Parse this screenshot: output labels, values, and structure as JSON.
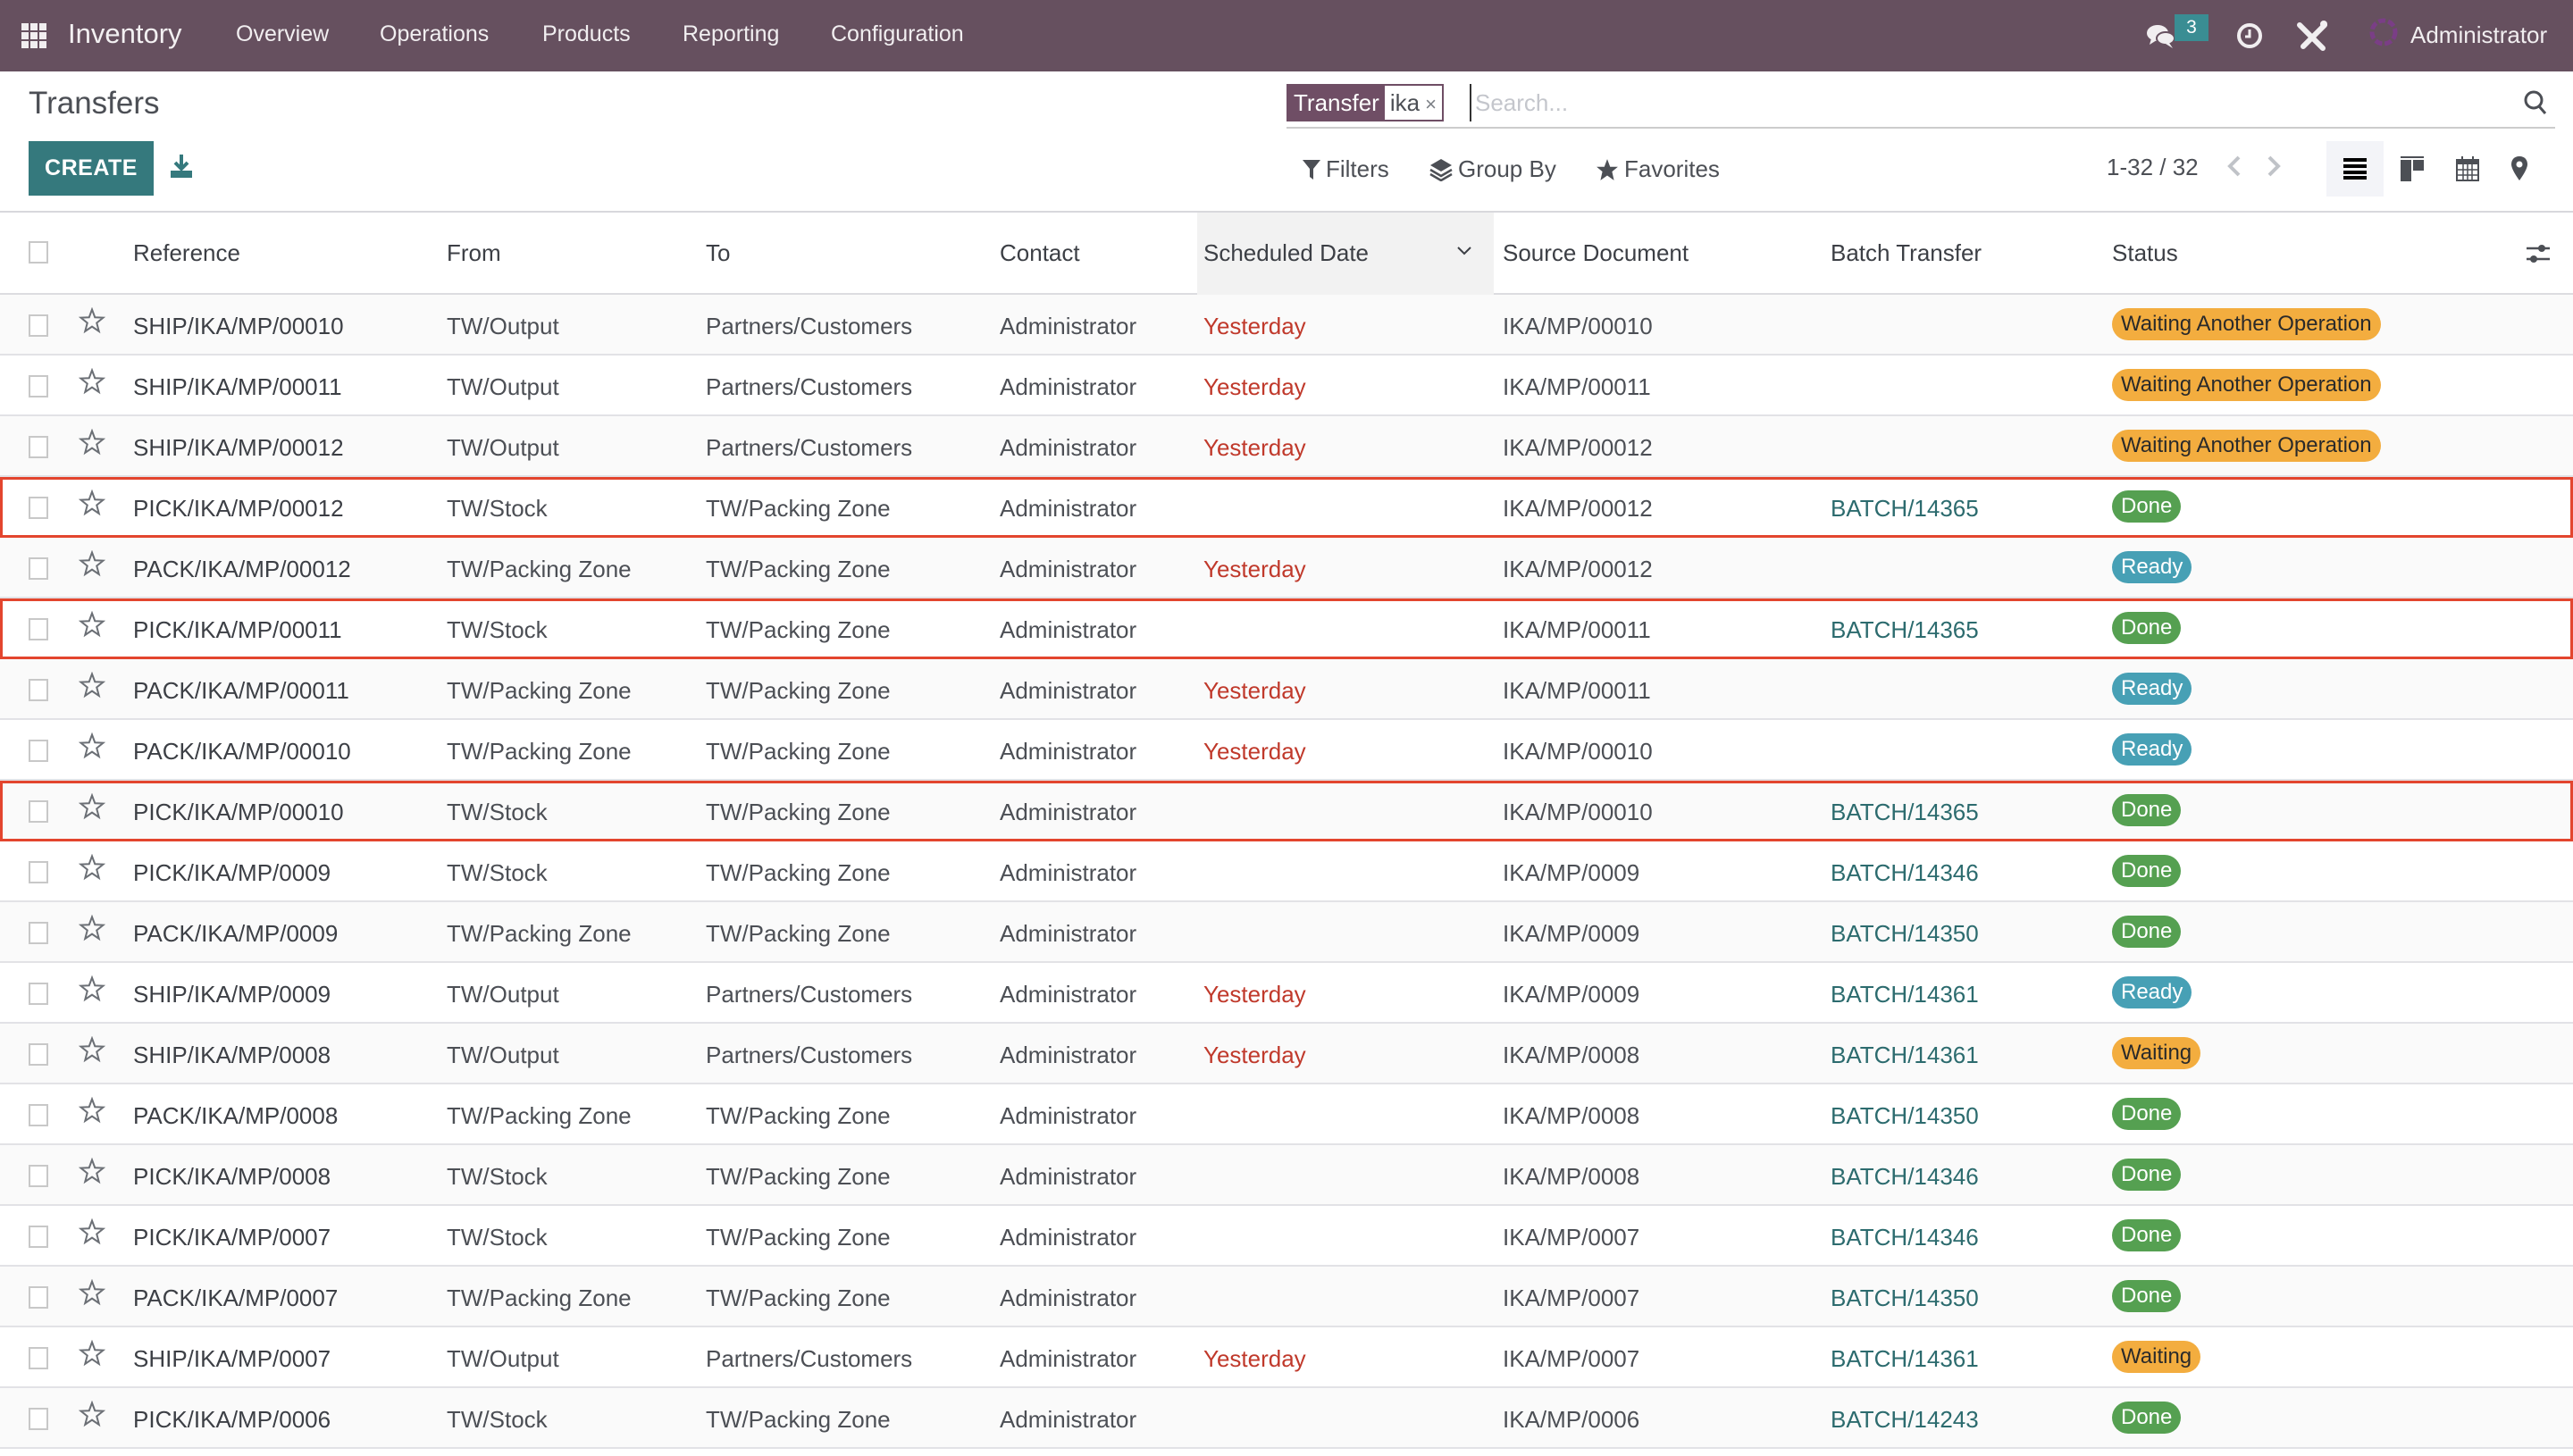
{
  "navbar": {
    "app_name": "Inventory",
    "menu": [
      "Overview",
      "Operations",
      "Products",
      "Reporting",
      "Configuration"
    ],
    "messages_count": "3",
    "user": "Administrator",
    "icons": [
      "apps-grid-icon",
      "chat-icon",
      "clock-icon",
      "tools-icon",
      "company-logo"
    ]
  },
  "control_panel": {
    "title": "Transfers",
    "create_label": "CREATE",
    "search": {
      "facet_label": "Transfer",
      "facet_value": "ika",
      "facet_remove": "×",
      "placeholder": "Search..."
    },
    "filters_label": "Filters",
    "group_by_label": "Group By",
    "favorites_label": "Favorites",
    "pager": "1-32 / 32",
    "views": [
      "list",
      "kanban",
      "calendar",
      "map"
    ],
    "active_view": "list"
  },
  "table": {
    "columns": [
      "Reference",
      "From",
      "To",
      "Contact",
      "Scheduled Date",
      "Source Document",
      "Batch Transfer",
      "Status"
    ],
    "sorted_column": "Scheduled Date",
    "rows": [
      {
        "ref": "SHIP/IKA/MP/00010",
        "from": "TW/Output",
        "to": "Partners/Customers",
        "contact": "Administrator",
        "date": "Yesterday",
        "source": "IKA/MP/00010",
        "batch": "",
        "status": "Waiting Another Operation",
        "status_type": "waiting",
        "highlight": false
      },
      {
        "ref": "SHIP/IKA/MP/00011",
        "from": "TW/Output",
        "to": "Partners/Customers",
        "contact": "Administrator",
        "date": "Yesterday",
        "source": "IKA/MP/00011",
        "batch": "",
        "status": "Waiting Another Operation",
        "status_type": "waiting",
        "highlight": false
      },
      {
        "ref": "SHIP/IKA/MP/00012",
        "from": "TW/Output",
        "to": "Partners/Customers",
        "contact": "Administrator",
        "date": "Yesterday",
        "source": "IKA/MP/00012",
        "batch": "",
        "status": "Waiting Another Operation",
        "status_type": "waiting",
        "highlight": false
      },
      {
        "ref": "PICK/IKA/MP/00012",
        "from": "TW/Stock",
        "to": "TW/Packing Zone",
        "contact": "Administrator",
        "date": "",
        "source": "IKA/MP/00012",
        "batch": "BATCH/14365",
        "status": "Done",
        "status_type": "done",
        "highlight": true
      },
      {
        "ref": "PACK/IKA/MP/00012",
        "from": "TW/Packing Zone",
        "to": "TW/Packing Zone",
        "contact": "Administrator",
        "date": "Yesterday",
        "source": "IKA/MP/00012",
        "batch": "",
        "status": "Ready",
        "status_type": "ready",
        "highlight": false
      },
      {
        "ref": "PICK/IKA/MP/00011",
        "from": "TW/Stock",
        "to": "TW/Packing Zone",
        "contact": "Administrator",
        "date": "",
        "source": "IKA/MP/00011",
        "batch": "BATCH/14365",
        "status": "Done",
        "status_type": "done",
        "highlight": true
      },
      {
        "ref": "PACK/IKA/MP/00011",
        "from": "TW/Packing Zone",
        "to": "TW/Packing Zone",
        "contact": "Administrator",
        "date": "Yesterday",
        "source": "IKA/MP/00011",
        "batch": "",
        "status": "Ready",
        "status_type": "ready",
        "highlight": false
      },
      {
        "ref": "PACK/IKA/MP/00010",
        "from": "TW/Packing Zone",
        "to": "TW/Packing Zone",
        "contact": "Administrator",
        "date": "Yesterday",
        "source": "IKA/MP/00010",
        "batch": "",
        "status": "Ready",
        "status_type": "ready",
        "highlight": false
      },
      {
        "ref": "PICK/IKA/MP/00010",
        "from": "TW/Stock",
        "to": "TW/Packing Zone",
        "contact": "Administrator",
        "date": "",
        "source": "IKA/MP/00010",
        "batch": "BATCH/14365",
        "status": "Done",
        "status_type": "done",
        "highlight": true
      },
      {
        "ref": "PICK/IKA/MP/0009",
        "from": "TW/Stock",
        "to": "TW/Packing Zone",
        "contact": "Administrator",
        "date": "",
        "source": "IKA/MP/0009",
        "batch": "BATCH/14346",
        "status": "Done",
        "status_type": "done",
        "highlight": false
      },
      {
        "ref": "PACK/IKA/MP/0009",
        "from": "TW/Packing Zone",
        "to": "TW/Packing Zone",
        "contact": "Administrator",
        "date": "",
        "source": "IKA/MP/0009",
        "batch": "BATCH/14350",
        "status": "Done",
        "status_type": "done",
        "highlight": false
      },
      {
        "ref": "SHIP/IKA/MP/0009",
        "from": "TW/Output",
        "to": "Partners/Customers",
        "contact": "Administrator",
        "date": "Yesterday",
        "source": "IKA/MP/0009",
        "batch": "BATCH/14361",
        "status": "Ready",
        "status_type": "ready",
        "highlight": false
      },
      {
        "ref": "SHIP/IKA/MP/0008",
        "from": "TW/Output",
        "to": "Partners/Customers",
        "contact": "Administrator",
        "date": "Yesterday",
        "source": "IKA/MP/0008",
        "batch": "BATCH/14361",
        "status": "Waiting",
        "status_type": "waiting",
        "highlight": false
      },
      {
        "ref": "PACK/IKA/MP/0008",
        "from": "TW/Packing Zone",
        "to": "TW/Packing Zone",
        "contact": "Administrator",
        "date": "",
        "source": "IKA/MP/0008",
        "batch": "BATCH/14350",
        "status": "Done",
        "status_type": "done",
        "highlight": false
      },
      {
        "ref": "PICK/IKA/MP/0008",
        "from": "TW/Stock",
        "to": "TW/Packing Zone",
        "contact": "Administrator",
        "date": "",
        "source": "IKA/MP/0008",
        "batch": "BATCH/14346",
        "status": "Done",
        "status_type": "done",
        "highlight": false
      },
      {
        "ref": "PICK/IKA/MP/0007",
        "from": "TW/Stock",
        "to": "TW/Packing Zone",
        "contact": "Administrator",
        "date": "",
        "source": "IKA/MP/0007",
        "batch": "BATCH/14346",
        "status": "Done",
        "status_type": "done",
        "highlight": false
      },
      {
        "ref": "PACK/IKA/MP/0007",
        "from": "TW/Packing Zone",
        "to": "TW/Packing Zone",
        "contact": "Administrator",
        "date": "",
        "source": "IKA/MP/0007",
        "batch": "BATCH/14350",
        "status": "Done",
        "status_type": "done",
        "highlight": false
      },
      {
        "ref": "SHIP/IKA/MP/0007",
        "from": "TW/Output",
        "to": "Partners/Customers",
        "contact": "Administrator",
        "date": "Yesterday",
        "source": "IKA/MP/0007",
        "batch": "BATCH/14361",
        "status": "Waiting",
        "status_type": "waiting",
        "highlight": false
      },
      {
        "ref": "PICK/IKA/MP/0006",
        "from": "TW/Stock",
        "to": "TW/Packing Zone",
        "contact": "Administrator",
        "date": "",
        "source": "IKA/MP/0006",
        "batch": "BATCH/14243",
        "status": "Done",
        "status_type": "done",
        "highlight": false
      }
    ]
  },
  "colors": {
    "navbar": "#66505f",
    "primary": "#35797d",
    "facet": "#6f4e65",
    "late_date": "#c0392b",
    "batch_link": "#2c6b6e",
    "status_done": "#55a051",
    "status_ready": "#47a0b5",
    "status_waiting": "#f3ad3f",
    "highlight_border": "#e3452e"
  }
}
